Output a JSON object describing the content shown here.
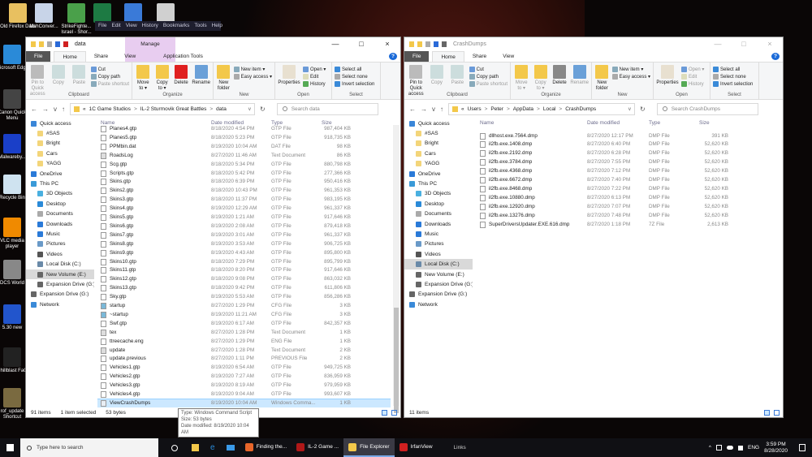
{
  "desktop": {
    "icons_top": [
      {
        "label": "Old Firefox Data",
        "color": "#e8c060"
      },
      {
        "label": "MshConver...",
        "color": "#c8d4e8"
      },
      {
        "label": "StrikeFighte... Israel - Shor...",
        "color": "#4aa04a"
      },
      {
        "label": "",
        "color": "#1d7a43"
      },
      {
        "label": "",
        "color": "#3a7ad8"
      },
      {
        "label": "",
        "color": "#d0d0d0"
      }
    ],
    "icons_left": [
      {
        "label": "Microsoft Edge",
        "color": "#2a8ad8"
      },
      {
        "label": "Canon Quick Menu",
        "color": "#444"
      },
      {
        "label": "Malwareby...",
        "color": "#1a3fc8"
      },
      {
        "label": "Recycle Bin",
        "color": "#cfe3f0"
      },
      {
        "label": "VLC media player",
        "color": "#f08a00"
      },
      {
        "label": "DCS World",
        "color": "#888"
      },
      {
        "label": "5.30 new",
        "color": "#2255cc"
      },
      {
        "label": "Chillblast FaQ",
        "color": "#222"
      },
      {
        "label": "rof_update Shortcut",
        "color": "#7a6a40"
      }
    ]
  },
  "firefox_menu": [
    "File",
    "Edit",
    "View",
    "History",
    "Bookmarks",
    "Tools",
    "Help"
  ],
  "ribbon": {
    "tabs": {
      "file": "File",
      "home": "Home",
      "share": "Share",
      "view": "View",
      "manage": "Manage",
      "app_tools": "Application Tools"
    },
    "clipboard": {
      "pin": "Pin to Quick access",
      "copy": "Copy",
      "paste": "Paste",
      "cut": "Cut",
      "copy_path": "Copy path",
      "paste_shortcut": "Paste shortcut",
      "label": "Clipboard"
    },
    "organize": {
      "move_to": "Move to ▾",
      "copy_to": "Copy to ▾",
      "delete": "Delete",
      "rename": "Rename",
      "label": "Organize"
    },
    "new": {
      "new_folder": "New folder",
      "new_item": "New item ▾",
      "easy_access": "Easy access ▾",
      "label": "New"
    },
    "open": {
      "properties": "Properties",
      "open": "Open ▾",
      "edit": "Edit",
      "history": "History",
      "label": "Open"
    },
    "select": {
      "select_all": "Select all",
      "select_none": "Select none",
      "invert": "Invert selection",
      "label": "Select"
    }
  },
  "left_window": {
    "title": "data",
    "breadcrumb": [
      "«",
      "1C Game Studios",
      "IL-2 Sturmovik Great Battles",
      "data"
    ],
    "search_placeholder": "Search data",
    "columns": {
      "name": "Name",
      "date": "Date modified",
      "type": "Type",
      "size": "Size"
    },
    "files": [
      [
        "Planes4.gtp",
        "8/18/2020 4:54 PM",
        "GTP File",
        "987,404 KB",
        "f"
      ],
      [
        "Planes5.gtp",
        "8/18/2020 5:23 PM",
        "GTP File",
        "918,735 KB",
        "f"
      ],
      [
        "PPMbin.dat",
        "8/19/2020 10:04 AM",
        "DAT File",
        "98 KB",
        "f"
      ],
      [
        "RoadsLog",
        "8/27/2020 11:46 AM",
        "Text Document",
        "86 KB",
        "t"
      ],
      [
        "Scg.gtp",
        "8/18/2020 5:34 PM",
        "GTP File",
        "880,798 KB",
        "f"
      ],
      [
        "Scripts.gtp",
        "8/18/2020 5:42 PM",
        "GTP File",
        "277,366 KB",
        "f"
      ],
      [
        "Skins.gtp",
        "8/18/2020 6:39 PM",
        "GTP File",
        "950,416 KB",
        "f"
      ],
      [
        "Skins2.gtp",
        "8/18/2020 10:43 PM",
        "GTP File",
        "961,353 KB",
        "f"
      ],
      [
        "Skins3.gtp",
        "8/18/2020 11:37 PM",
        "GTP File",
        "983,195 KB",
        "f"
      ],
      [
        "Skins4.gtp",
        "8/19/2020 12:29 AM",
        "GTP File",
        "961,337 KB",
        "f"
      ],
      [
        "Skins5.gtp",
        "8/19/2020 1:21 AM",
        "GTP File",
        "917,646 KB",
        "f"
      ],
      [
        "Skins6.gtp",
        "8/19/2020 2:08 AM",
        "GTP File",
        "879,418 KB",
        "f"
      ],
      [
        "Skins7.gtp",
        "8/19/2020 3:01 AM",
        "GTP File",
        "961,337 KB",
        "f"
      ],
      [
        "Skins8.gtp",
        "8/19/2020 3:53 AM",
        "GTP File",
        "906,725 KB",
        "f"
      ],
      [
        "Skins9.gtp",
        "8/19/2020 4:43 AM",
        "GTP File",
        "895,800 KB",
        "f"
      ],
      [
        "Skins10.gtp",
        "8/18/2020 7:29 PM",
        "GTP File",
        "895,799 KB",
        "f"
      ],
      [
        "Skins11.gtp",
        "8/18/2020 8:20 PM",
        "GTP File",
        "917,646 KB",
        "f"
      ],
      [
        "Skins12.gtp",
        "8/18/2020 9:08 PM",
        "GTP File",
        "863,032 KB",
        "f"
      ],
      [
        "Skins13.gtp",
        "8/18/2020 9:42 PM",
        "GTP File",
        "611,806 KB",
        "f"
      ],
      [
        "Sky.gtp",
        "8/19/2020 5:53 AM",
        "GTP File",
        "856,286 KB",
        "f"
      ],
      [
        "startup",
        "8/27/2020 1:29 PM",
        "CFG File",
        "3 KB",
        "c"
      ],
      [
        "~startup",
        "8/19/2020 11:21 AM",
        "CFG File",
        "3 KB",
        "c"
      ],
      [
        "Swf.gtp",
        "8/19/2020 6:17 AM",
        "GTP File",
        "842,357 KB",
        "f"
      ],
      [
        "tex",
        "8/27/2020 1:28 PM",
        "Text Document",
        "1 KB",
        "t"
      ],
      [
        "ttreecache.eng",
        "8/27/2020 1:29 PM",
        "ENG File",
        "1 KB",
        "f"
      ],
      [
        "update",
        "8/27/2020 1:28 PM",
        "Text Document",
        "2 KB",
        "t"
      ],
      [
        "update.previous",
        "8/27/2020 1:11 PM",
        "PREVIOUS File",
        "2 KB",
        "f"
      ],
      [
        "Vehicles1.gtp",
        "8/19/2020 6:54 AM",
        "GTP File",
        "949,725 KB",
        "f"
      ],
      [
        "Vehicles2.gtp",
        "8/19/2020 7:27 AM",
        "GTP File",
        "836,959 KB",
        "f"
      ],
      [
        "Vehicles3.gtp",
        "8/19/2020 8:19 AM",
        "GTP File",
        "979,959 KB",
        "f"
      ],
      [
        "Vehicles4.gtp",
        "8/19/2020 9:04 AM",
        "GTP File",
        "993,607 KB",
        "f"
      ],
      [
        "ViewCrashDumps",
        "8/19/2020 10:04 AM",
        "Windows Comma...",
        "1 KB",
        "s"
      ]
    ],
    "selected_index": 31,
    "status": {
      "count": "91 items",
      "selected": "1 item selected",
      "size": "53 bytes"
    },
    "nav_selected": "New Volume (E:)"
  },
  "right_window": {
    "title": "CrashDumps",
    "breadcrumb": [
      "«",
      "Users",
      "Peter",
      "AppData",
      "Local",
      "CrashDumps"
    ],
    "search_placeholder": "Search CrashDumps",
    "columns": {
      "name": "Name",
      "date": "Date modified",
      "type": "Type",
      "size": "Size"
    },
    "files": [
      [
        "dllhost.exe.7564.dmp",
        "8/27/2020 12:17 PM",
        "DMP File",
        "391 KB",
        "f"
      ],
      [
        "il2fb.exe.1408.dmp",
        "8/27/2020 6:40 PM",
        "DMP File",
        "52,620 KB",
        "f"
      ],
      [
        "il2fb.exe.2192.dmp",
        "8/27/2020 6:28 PM",
        "DMP File",
        "52,620 KB",
        "f"
      ],
      [
        "il2fb.exe.3784.dmp",
        "8/27/2020 7:55 PM",
        "DMP File",
        "52,620 KB",
        "f"
      ],
      [
        "il2fb.exe.4368.dmp",
        "8/27/2020 7:12 PM",
        "DMP File",
        "52,620 KB",
        "f"
      ],
      [
        "il2fb.exe.6672.dmp",
        "8/27/2020 7:40 PM",
        "DMP File",
        "52,620 KB",
        "f"
      ],
      [
        "il2fb.exe.8468.dmp",
        "8/27/2020 7:22 PM",
        "DMP File",
        "52,620 KB",
        "f"
      ],
      [
        "il2fb.exe.10880.dmp",
        "8/27/2020 6:13 PM",
        "DMP File",
        "52,620 KB",
        "f"
      ],
      [
        "il2fb.exe.12920.dmp",
        "8/27/2020 7:07 PM",
        "DMP File",
        "52,620 KB",
        "f"
      ],
      [
        "il2fb.exe.13276.dmp",
        "8/27/2020 7:48 PM",
        "DMP File",
        "52,620 KB",
        "f"
      ],
      [
        "SuperDriversUpdater.EXE.616.dmp",
        "8/27/2020 1:18 PM",
        "7Z File",
        "2,613 KB",
        "f"
      ]
    ],
    "selected_index": -1,
    "status": {
      "count": "11 items",
      "selected": "",
      "size": ""
    },
    "nav_selected": "Local Disk (C:)"
  },
  "nav_items": [
    [
      "Quick access",
      "#3a86d8",
      0
    ],
    [
      "#SAS",
      "#f3d57a",
      1
    ],
    [
      "Bright",
      "#f3d57a",
      1
    ],
    [
      "Cars",
      "#f3d57a",
      1
    ],
    [
      "YAGG",
      "#f3d57a",
      1
    ],
    [
      "OneDrive",
      "#2a7ad8",
      0
    ],
    [
      "This PC",
      "#3a9ad8",
      0
    ],
    [
      "3D Objects",
      "#4ab0e0",
      1
    ],
    [
      "Desktop",
      "#2a8ad8",
      1
    ],
    [
      "Documents",
      "#aaa",
      1
    ],
    [
      "Downloads",
      "#2a7ad8",
      1
    ],
    [
      "Music",
      "#2a7ad8",
      1
    ],
    [
      "Pictures",
      "#6a9ac8",
      1
    ],
    [
      "Videos",
      "#555",
      1
    ],
    [
      "Local Disk (C:)",
      "#6a8aa8",
      1
    ],
    [
      "New Volume (E:)",
      "#666",
      1
    ],
    [
      "Expansion Drive (G:)",
      "#666",
      1
    ],
    [
      "Expansion Drive (G:)",
      "#666",
      0
    ],
    [
      "Network",
      "#3a8ad8",
      0
    ]
  ],
  "tooltip": {
    "type": "Type: Windows Command Script",
    "size": "Size: 53 bytes",
    "date": "Date modified: 8/19/2020 10:04 AM"
  },
  "taskbar": {
    "search_placeholder": "Type here to search",
    "apps": [
      {
        "label": "Finding the...",
        "color": "#e8662a",
        "active": false
      },
      {
        "label": "IL-2 Game ...",
        "color": "#b01818",
        "active": false
      },
      {
        "label": "File Explorer",
        "color": "#f3c84a",
        "active": true
      },
      {
        "label": "IrfanView",
        "color": "#d02020",
        "active": false
      }
    ],
    "links": "Links",
    "lang": "ENG",
    "time": "3:59 PM",
    "date": "8/28/2020"
  }
}
